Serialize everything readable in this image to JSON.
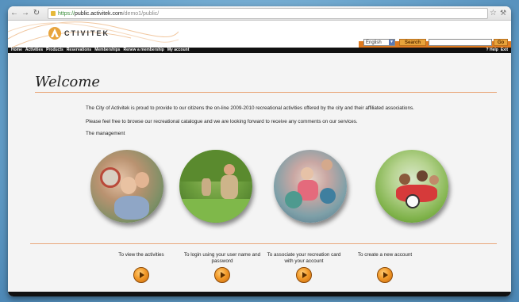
{
  "browser": {
    "url_scheme": "https://",
    "url_host": "public.activitek.com",
    "url_path": "/demo1/public/"
  },
  "header": {
    "logo_text": "CTIVITEK",
    "language": "English",
    "search_label": "Search",
    "search_value": "",
    "go_label": "Go"
  },
  "menu": {
    "items": [
      "Home",
      "Activities",
      "Products",
      "Reservations",
      "Memberships",
      "Renew a membership",
      "My account"
    ],
    "right_items": [
      "? Help",
      "Exit"
    ]
  },
  "main": {
    "welcome": "Welcome",
    "paragraphs": [
      "The City of Activitek is proud to provide to our citizens the on-line 2009-2010 recreational activities offered by the city and their affiliated associations.",
      "Please feel free to browse our recreational catalogue and we are looking forward to receive any comments on our services.",
      "The management"
    ],
    "actions": [
      {
        "caption": "To view the activities"
      },
      {
        "caption": "To login using your user name and password"
      },
      {
        "caption": "To associate your recreation card with your account"
      },
      {
        "caption": "To create a new account"
      }
    ]
  },
  "colors": {
    "accent_orange": "#e07b20",
    "menu_bg": "#111111",
    "divider": "#e9a77a"
  }
}
